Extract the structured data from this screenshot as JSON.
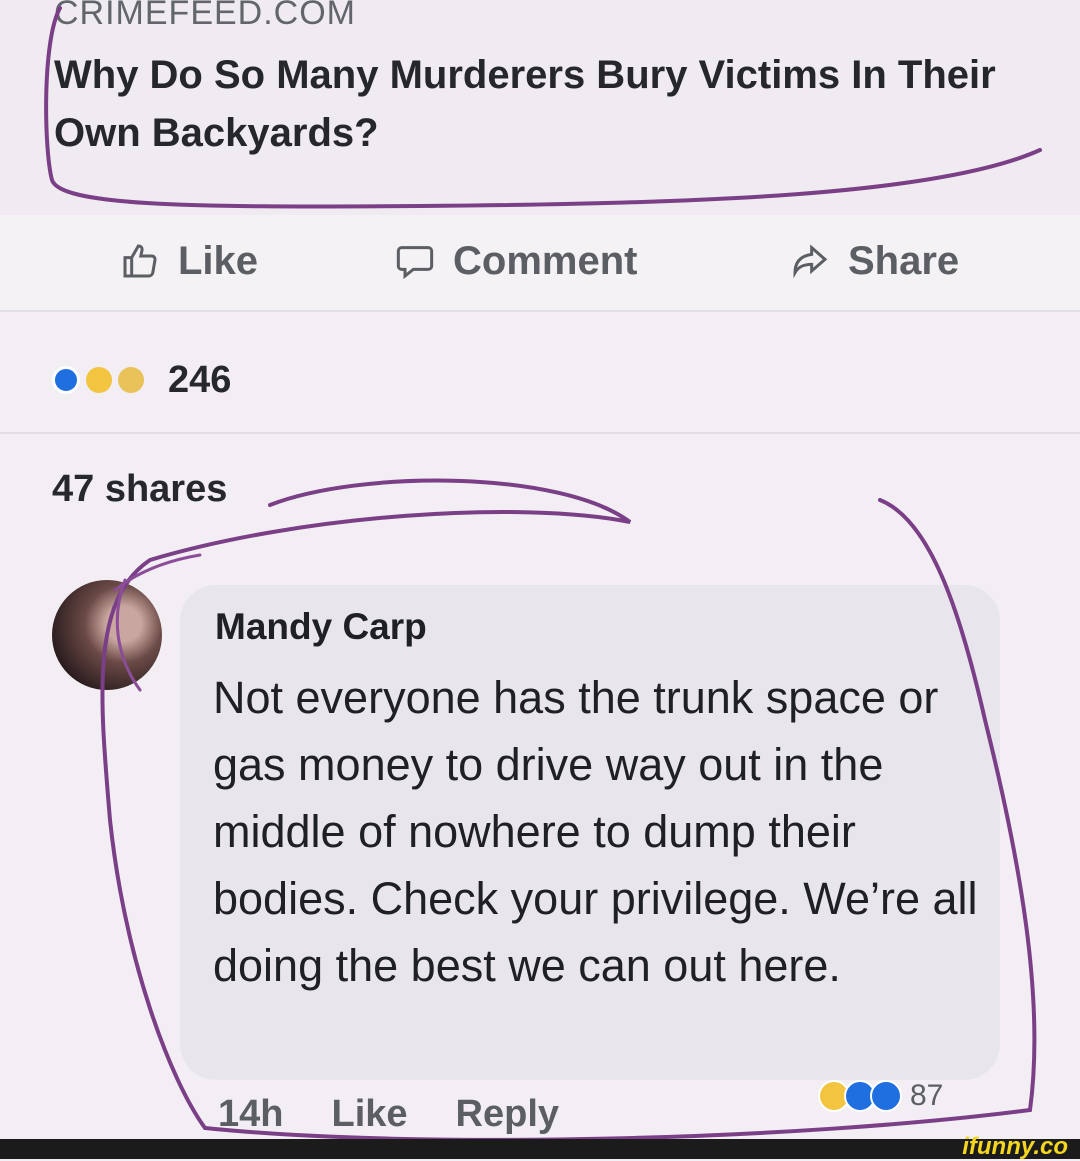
{
  "post": {
    "link_domain": "CRIMEFEED.COM",
    "link_title": "Why Do So Many Murderers Bury Victims In Their Own Backyards?"
  },
  "actions": {
    "like_label": "Like",
    "comment_label": "Comment",
    "share_label": "Share"
  },
  "reactions": {
    "count": "246",
    "icons": [
      "like-reaction-icon",
      "wow-reaction-icon",
      "haha-reaction-icon"
    ]
  },
  "shares_text": "47 shares",
  "comment": {
    "author": "Mandy Carp",
    "text": "Not everyone has the trunk space or gas money to drive way out in the middle of nowhere to dump their bodies. Check your privilege. We’re all doing the best we can out here.",
    "time": "14h",
    "like_label": "Like",
    "reply_label": "Reply",
    "reaction_count": "87"
  },
  "watermark": "ifunny.co",
  "colors": {
    "scribble": "#7a3f86",
    "like_blue": "#1f6fe0",
    "wow_yellow": "#f2c440"
  }
}
